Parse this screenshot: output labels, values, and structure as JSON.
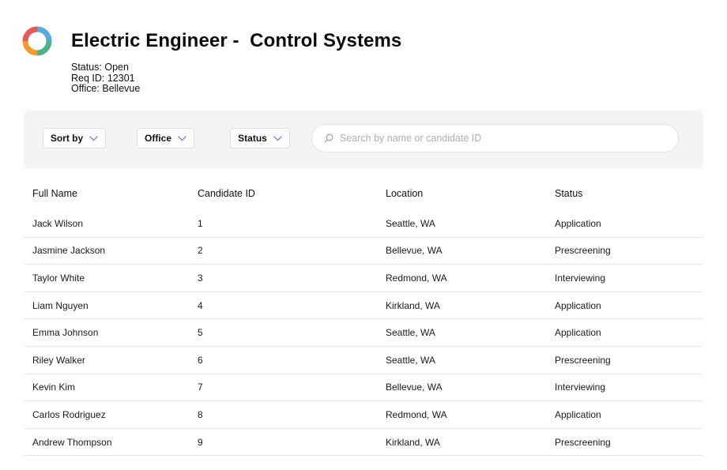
{
  "header": {
    "title": "Electric Engineer -  Control Systems",
    "status_line": "Status: Open",
    "req_line": "Req ID: 12301",
    "office_line": "Office: Bellevue"
  },
  "filters": {
    "sort_label": "Sort by",
    "office_label": "Office",
    "status_label": "Status"
  },
  "search": {
    "placeholder": "Search by name or candidate ID",
    "value": ""
  },
  "table": {
    "columns": [
      "Full Name",
      "Candidate ID",
      "Location",
      "Status"
    ],
    "rows": [
      [
        "Jack Wilson",
        "1",
        "Seattle, WA",
        "Application"
      ],
      [
        "Jasmine Jackson",
        "2",
        "Bellevue, WA",
        "Prescreening"
      ],
      [
        "Taylor White",
        "3",
        "Redmond, WA",
        "Interviewing"
      ],
      [
        "Liam Nguyen",
        "4",
        "Kirkland, WA",
        "Application"
      ],
      [
        "Emma Johnson",
        "5",
        "Seattle, WA",
        "Application"
      ],
      [
        "Riley Walker",
        "6",
        "Seattle, WA",
        "Prescreening"
      ],
      [
        "Kevin Kim",
        "7",
        "Bellevue, WA",
        "Interviewing"
      ],
      [
        "Carlos Rodriguez",
        "8",
        "Redmond, WA",
        "Application"
      ],
      [
        "Andrew Thompson",
        "9",
        "Kirkland, WA",
        "Prescreening"
      ]
    ]
  },
  "icons": {
    "logo": "circular-arrows-logo",
    "dropdown": "chevron-down-icon",
    "search": "search-icon"
  },
  "colors": {
    "chevron": "#8a7fe0",
    "filter_bar_bg": "#f4f4f4",
    "logo_blue": "#5aa7dc",
    "logo_orange": "#f29a2e",
    "logo_green": "#4bb38a",
    "logo_red": "#e45a5a"
  }
}
